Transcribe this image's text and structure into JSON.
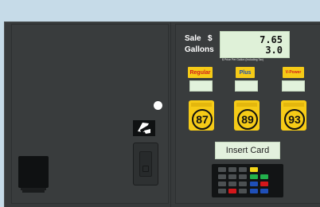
{
  "display": {
    "sale_label": "Sale",
    "dollar_sign": "$",
    "gallons_label": "Gallons",
    "sale_value": "7.65",
    "gallons_value": "3.0",
    "price_note": "$ Price Per Gallon (Including Tax)"
  },
  "grades": [
    {
      "name": "Regular",
      "octane": "87",
      "name_color": "#d3201a"
    },
    {
      "name": "Plus",
      "octane": "89",
      "name_color": "#1d4fb0"
    },
    {
      "name": "V-Power",
      "octane": "93",
      "name_color": "#d3201a"
    }
  ],
  "insert_card_label": "Insert Card",
  "colors": {
    "shell_yellow": "#f6cb17",
    "lcd_green": "#dff1d8",
    "pump_body": "#393c3d",
    "background": "#c6dbe8"
  }
}
